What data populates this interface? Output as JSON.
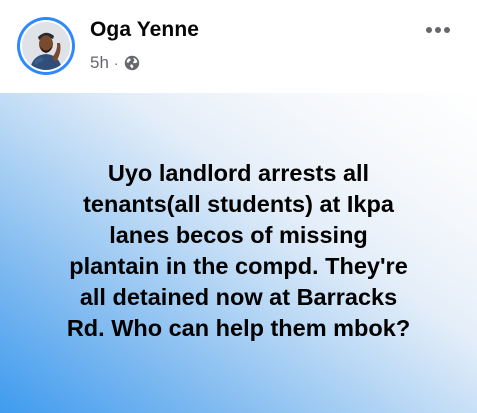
{
  "post": {
    "author": {
      "name": "Oga Yenne",
      "avatar_icon": "profile-photo"
    },
    "meta": {
      "time": "5h",
      "separator": "·",
      "privacy_icon": "globe-icon"
    },
    "more_icon": "more-horizontal-icon",
    "status_text": "Uyo landlord arrests all\ntenants(all students) at Ikpa\nlanes becos of missing\nplantain in the compd. They're\nall detained now at Barracks\nRd. Who can help them mbok?"
  },
  "colors": {
    "story_ring": "#2e89ff",
    "name": "#050505",
    "meta": "#65676b",
    "background_gradient": [
      "#3f9bef",
      "#7bb8f0",
      "#b9d8f5",
      "#e4eef9",
      "#ffffff"
    ]
  }
}
